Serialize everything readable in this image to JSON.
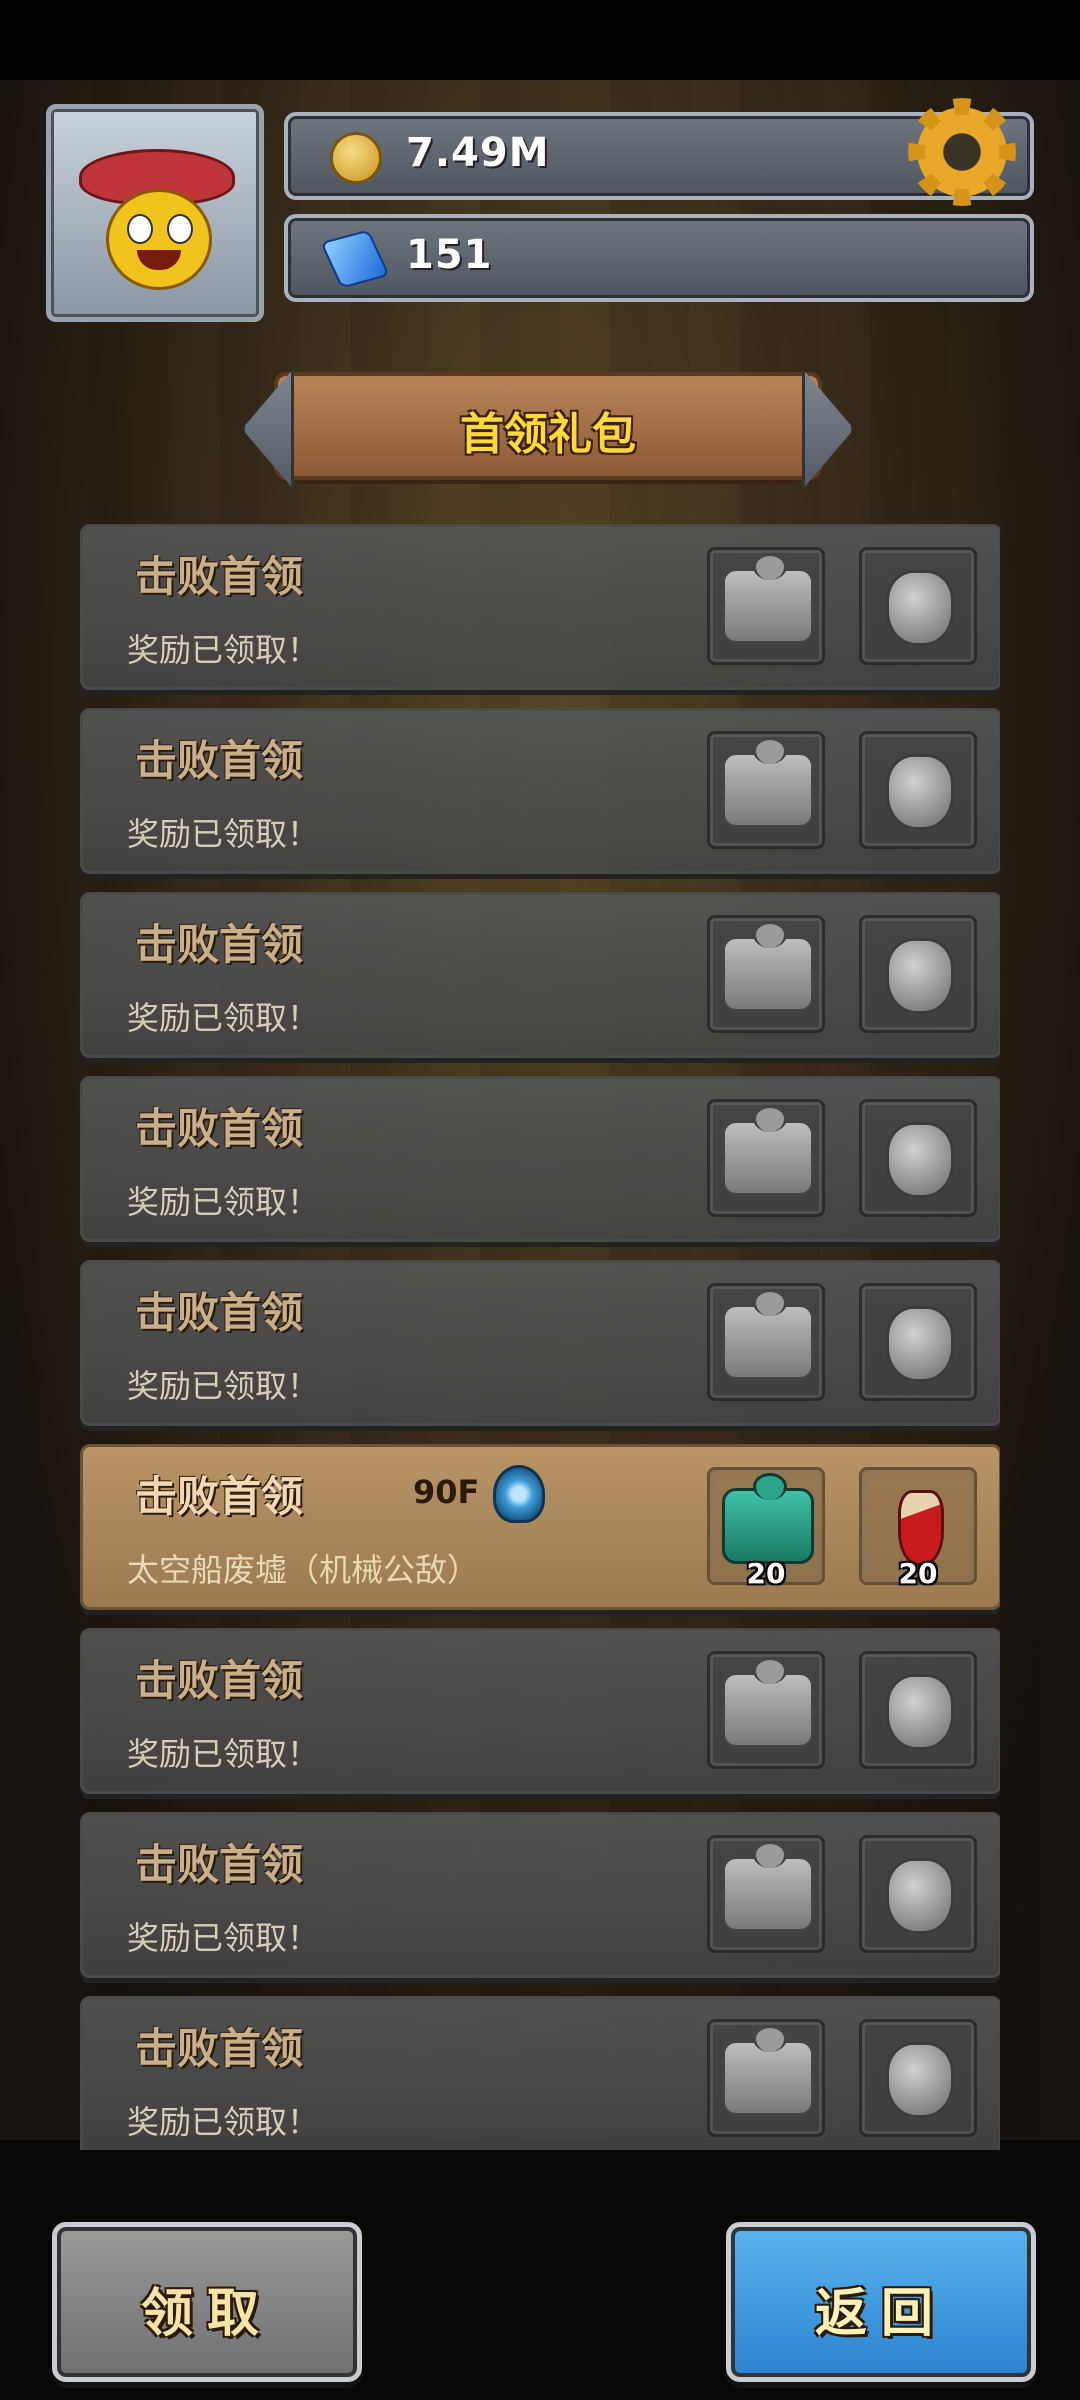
{
  "header": {
    "gold": "7.49M",
    "gems": "151",
    "icons": {
      "gold": "coin-icon",
      "gems": "blue-gem-icon",
      "settings": "gear-icon",
      "avatar": "hero-avatar-icon"
    }
  },
  "title": "首领礼包",
  "rows": [
    {
      "title": "击败首领",
      "subtitle": "奖励已领取！",
      "state": "claimed",
      "rewards": [
        "puzzle-piece-icon",
        "vase-icon"
      ]
    },
    {
      "title": "击败首领",
      "subtitle": "奖励已领取！",
      "state": "claimed",
      "rewards": [
        "puzzle-piece-icon",
        "shell-icon"
      ]
    },
    {
      "title": "击败首领",
      "subtitle": "奖励已领取！",
      "state": "claimed",
      "rewards": [
        "puzzle-piece-icon",
        "horn-shell-icon"
      ]
    },
    {
      "title": "击败首领",
      "subtitle": "奖励已领取！",
      "state": "claimed",
      "rewards": [
        "puzzle-piece-icon",
        "teapot-icon"
      ]
    },
    {
      "title": "击败首领",
      "subtitle": "奖励已领取！",
      "state": "claimed",
      "rewards": [
        "puzzle-piece-icon",
        "meat-icon"
      ]
    },
    {
      "title": "击败首领",
      "floor": "90F",
      "subtitle": "太空船废墟（机械公敌）",
      "state": "active",
      "rewards": [
        "teal-puzzle-piece-icon",
        "red-potion-icon"
      ],
      "counts": [
        "20",
        "20"
      ]
    },
    {
      "title": "击败首领",
      "subtitle": "奖励已领取！",
      "state": "claimed",
      "rewards": [
        "puzzle-piece-icon",
        "vase-icon"
      ]
    },
    {
      "title": "击败首领",
      "subtitle": "奖励已领取！",
      "state": "claimed",
      "rewards": [
        "puzzle-piece-icon",
        "horn-shell-icon"
      ]
    },
    {
      "title": "击败首领",
      "subtitle": "奖励已领取！",
      "state": "claimed",
      "rewards": [
        "puzzle-piece-icon",
        "shell-icon"
      ]
    }
  ],
  "buttons": {
    "claim": "领取",
    "back": "返回"
  }
}
